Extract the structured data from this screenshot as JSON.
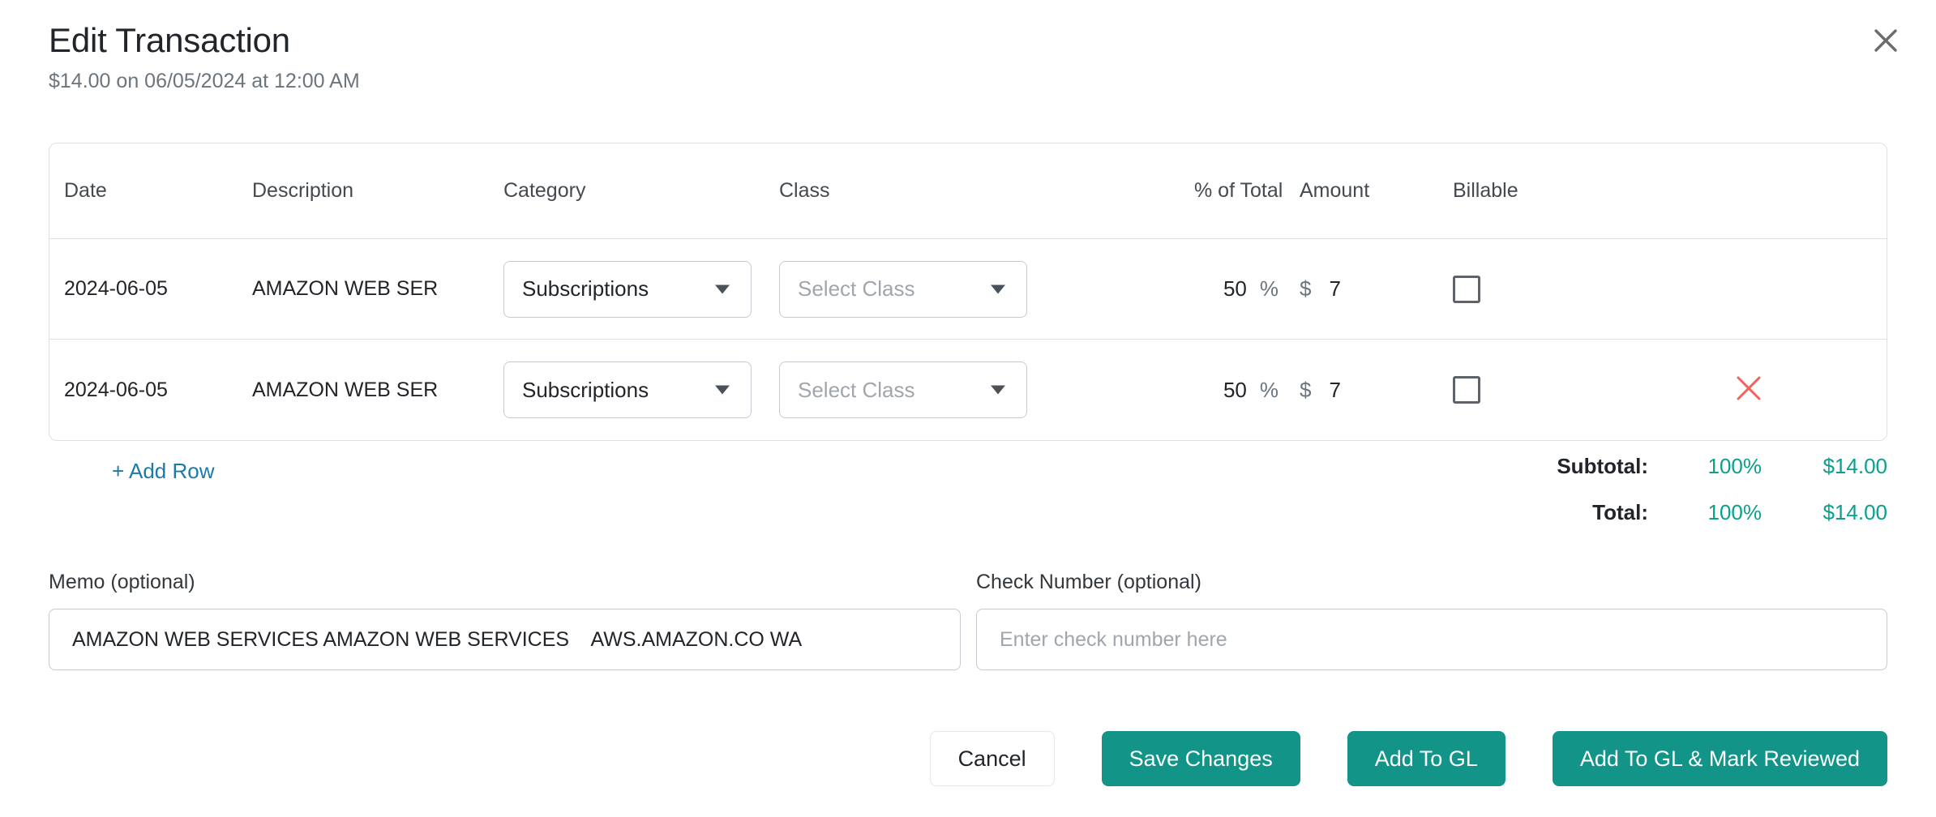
{
  "header": {
    "title": "Edit Transaction",
    "subtitle": "$14.00 on 06/05/2024 at 12:00 AM",
    "close_icon": "close-icon"
  },
  "table": {
    "columns": [
      "Date",
      "Description",
      "Category",
      "Class",
      "% of Total",
      "Amount",
      "Billable"
    ],
    "rows": [
      {
        "date": "2024-06-05",
        "description": "AMAZON WEB SER",
        "category": "Subscriptions",
        "class_placeholder": "Select Class",
        "class_value": "",
        "percent": "50",
        "percent_symbol": "%",
        "currency_symbol": "$",
        "amount": "7",
        "billable_checked": false,
        "deletable": false
      },
      {
        "date": "2024-06-05",
        "description": "AMAZON WEB SER",
        "category": "Subscriptions",
        "class_placeholder": "Select Class",
        "class_value": "",
        "percent": "50",
        "percent_symbol": "%",
        "currency_symbol": "$",
        "amount": "7",
        "billable_checked": false,
        "deletable": true
      }
    ]
  },
  "add_row_label": "+ Add Row",
  "totals": {
    "subtotal_label": "Subtotal:",
    "subtotal_percent": "100%",
    "subtotal_amount": "$14.00",
    "total_label": "Total:",
    "total_percent": "100%",
    "total_amount": "$14.00"
  },
  "memo": {
    "label": "Memo (optional)",
    "value": "AMAZON WEB SERVICES AMAZON WEB SERVICES    AWS.AMAZON.CO WA",
    "placeholder": ""
  },
  "check_number": {
    "label": "Check Number (optional)",
    "value": "",
    "placeholder": "Enter check number here"
  },
  "footer": {
    "cancel": "Cancel",
    "save_changes": "Save Changes",
    "add_to_gl": "Add To GL",
    "add_to_gl_reviewed": "Add To GL & Mark Reviewed"
  },
  "colors": {
    "primary_green": "#129488",
    "totals_teal": "#0aa08c",
    "link_blue": "#1b7aa8",
    "delete_red": "#f2635f",
    "border": "#dde1e6",
    "text": "#212529",
    "muted": "#6c757d"
  }
}
